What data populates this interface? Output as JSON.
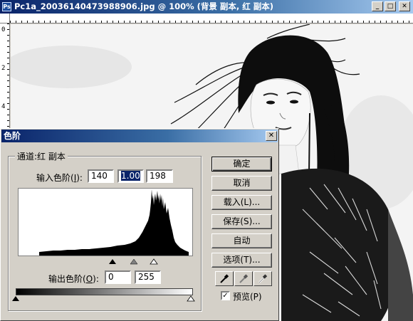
{
  "window": {
    "title": "Pc1a_20036140473988906.jpg @ 100% (背景 副本, 红 副本)",
    "app_icon": "Ps",
    "buttons": {
      "minimize": "_",
      "maximize": "□",
      "close": "✕"
    }
  },
  "rulers": {
    "left_numbers": [
      "0",
      "2",
      "4"
    ]
  },
  "dialog": {
    "title": "色阶",
    "close_glyph": "✕",
    "channel_label": "通道:红 副本",
    "input_levels_label": "输入色阶(",
    "input_levels_key": "I",
    "input_levels_suffix": "):",
    "input_black": "140",
    "input_gamma": "1.00",
    "input_white": "198",
    "output_levels_label": "输出色阶(",
    "output_levels_key": "O",
    "output_levels_suffix": "):",
    "output_black": "0",
    "output_white": "255",
    "buttons": {
      "ok": "确定",
      "cancel": "取消",
      "load": "载入(L)...",
      "save": "保存(S)...",
      "auto": "自动",
      "options": "选项(T)..."
    },
    "preview_label": "预览(P)",
    "preview_checked": true,
    "eyedroppers": [
      "black-eyedropper-icon",
      "gray-eyedropper-icon",
      "white-eyedropper-icon"
    ]
  },
  "colors": {
    "titlebar_start": "#0a246a",
    "titlebar_end": "#a6caf0",
    "dialog_bg": "#d4d0c8"
  }
}
